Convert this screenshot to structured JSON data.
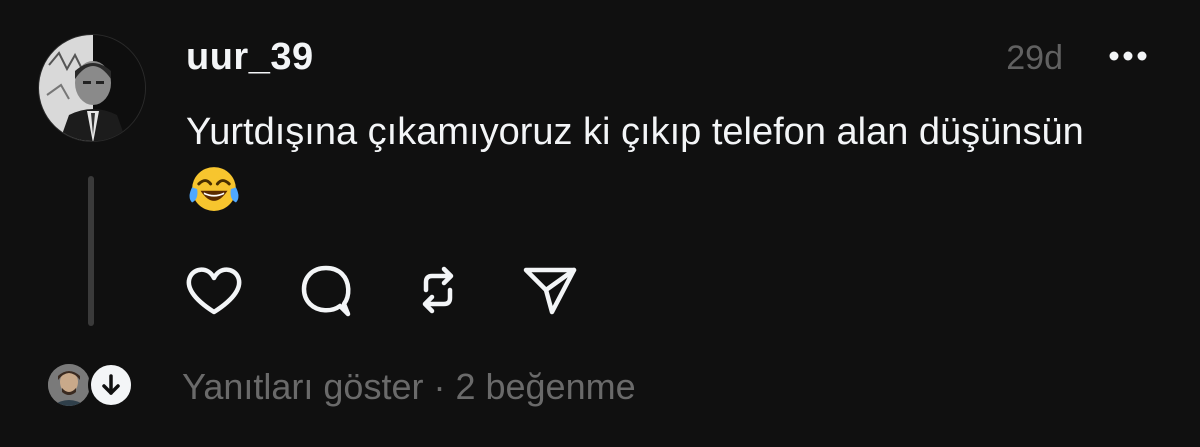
{
  "post": {
    "username": "uur_39",
    "time": "29d",
    "text": "Yurtdışına çıkamıyoruz ki çıkıp telefon alan düşünsün",
    "emoji_icon": "face-with-tears-of-joy-icon"
  },
  "actions": {
    "like_icon": "heart-icon",
    "reply_icon": "comment-icon",
    "repost_icon": "repost-icon",
    "share_icon": "send-icon"
  },
  "footer": {
    "show_replies": "Yanıtları göster",
    "separator": "·",
    "likes": "2 beğenme"
  },
  "colors": {
    "background": "#101010",
    "primary_text": "#f3f5f7",
    "secondary_text": "#616161",
    "thread_line": "#3a3a3a"
  }
}
